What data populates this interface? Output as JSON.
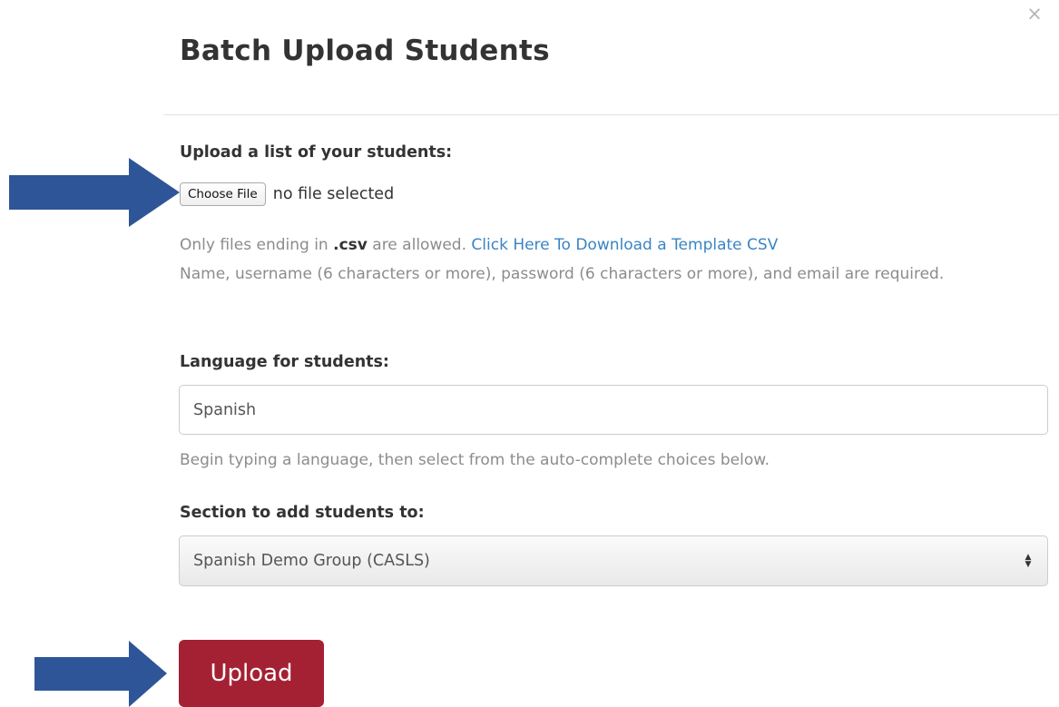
{
  "modal": {
    "title": "Batch Upload Students",
    "close_icon": "close-icon",
    "close_glyph": "×"
  },
  "upload": {
    "label": "Upload a list of your students:",
    "choose_file_label": "Choose File",
    "file_status": "no file selected",
    "help_prefix": "Only files ending in ",
    "help_ext": ".csv",
    "help_suffix": " are allowed. ",
    "template_link": "Click Here To Download a Template CSV",
    "requirements": "Name, username (6 characters or more), password (6 characters or more), and email are required."
  },
  "language": {
    "label": "Language for students:",
    "value": "Spanish",
    "help": "Begin typing a language, then select from the auto-complete choices below."
  },
  "section": {
    "label": "Section to add students to:",
    "selected": "Spanish Demo Group (CASLS)"
  },
  "actions": {
    "upload_label": "Upload"
  },
  "colors": {
    "upload_button": "#a42133",
    "link": "#3a84c4",
    "annotation_arrow": "#2e5597"
  }
}
